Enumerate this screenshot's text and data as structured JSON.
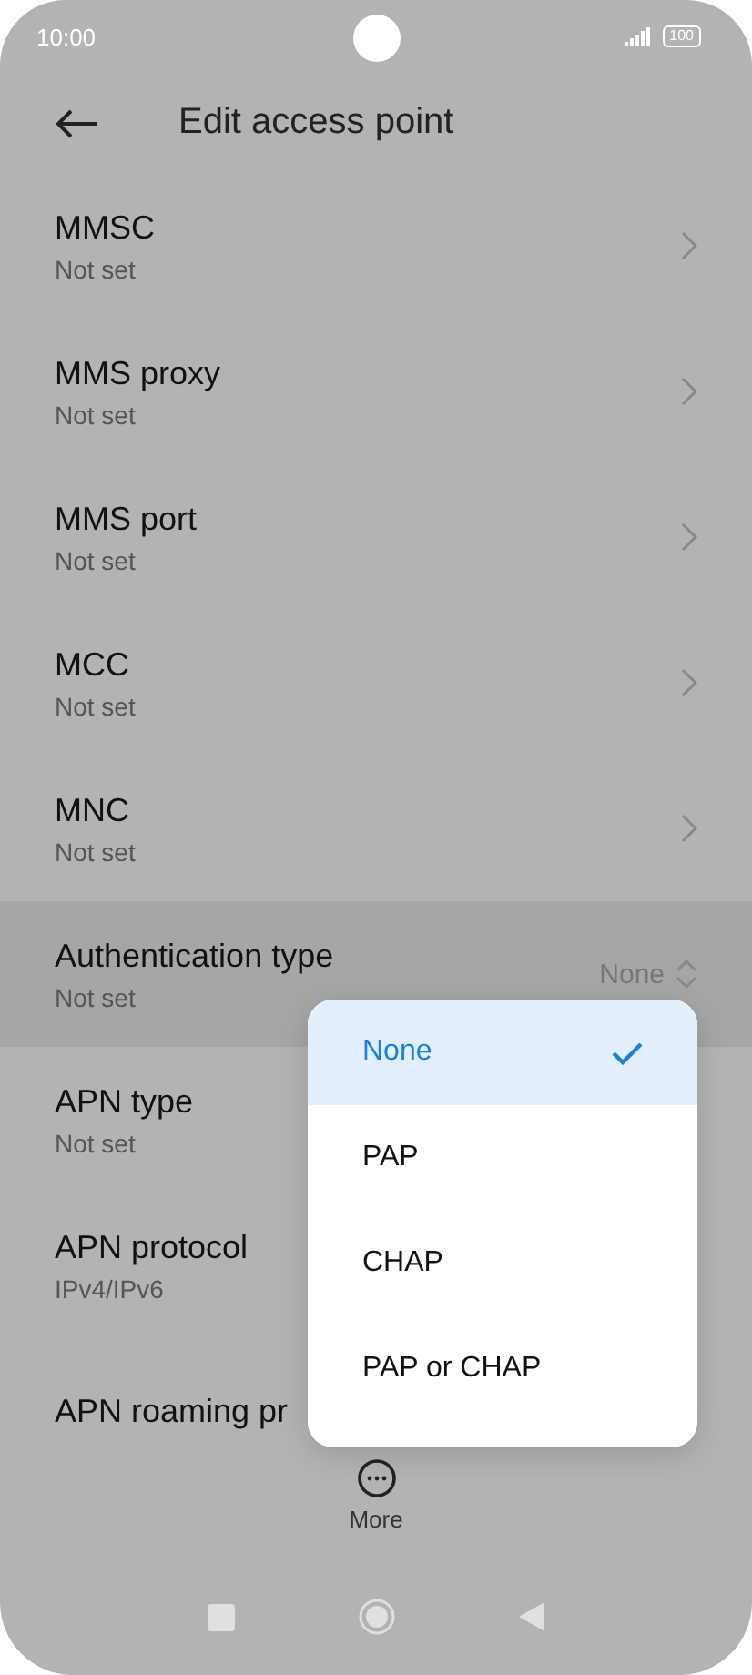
{
  "status_bar": {
    "time": "10:00",
    "battery": "100"
  },
  "header": {
    "title": "Edit access point"
  },
  "rows": [
    {
      "kind": "link",
      "title": "MMSC",
      "subtitle": "Not set",
      "selected": false,
      "chevron": true
    },
    {
      "kind": "link",
      "title": "MMS proxy",
      "subtitle": "Not set",
      "selected": false,
      "chevron": true
    },
    {
      "kind": "link",
      "title": "MMS port",
      "subtitle": "Not set",
      "selected": false,
      "chevron": true
    },
    {
      "kind": "link",
      "title": "MCC",
      "subtitle": "Not set",
      "selected": false,
      "chevron": true
    },
    {
      "kind": "link",
      "title": "MNC",
      "subtitle": "Not set",
      "selected": false,
      "chevron": true
    },
    {
      "kind": "select",
      "title": "Authentication type",
      "subtitle": "Not set",
      "value": "None",
      "selected": true
    },
    {
      "kind": "link",
      "title": "APN type",
      "subtitle": "Not set",
      "selected": false
    },
    {
      "kind": "link",
      "title": "APN protocol",
      "subtitle": "IPv4/IPv6",
      "selected": false
    },
    {
      "kind": "link",
      "title": "APN roaming pr",
      "selected": false
    }
  ],
  "menu": {
    "options": [
      {
        "label": "None",
        "selected": true
      },
      {
        "label": "PAP",
        "selected": false
      },
      {
        "label": "CHAP",
        "selected": false
      },
      {
        "label": "PAP or CHAP",
        "selected": false
      }
    ]
  },
  "bottom_action": {
    "label": "More"
  }
}
